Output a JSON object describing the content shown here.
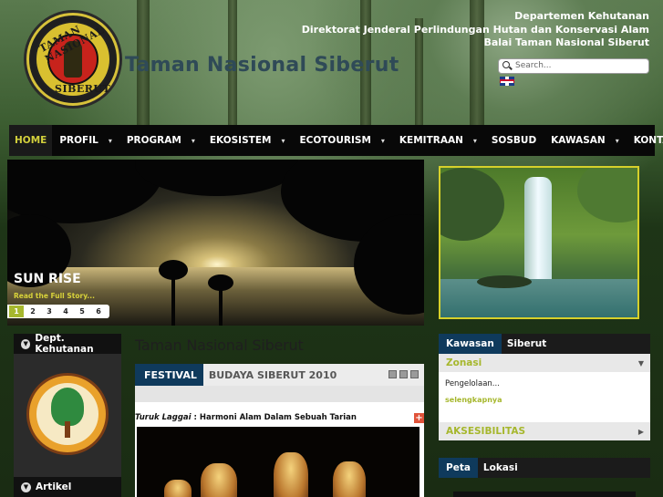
{
  "header": {
    "logo_top": "TAMAN NASIONAL",
    "logo_bottom": "SIBERUT",
    "site_title": "Taman Nasional Siberut",
    "org_lines": [
      "Departemen Kehutanan",
      "Direktorat Jenderal Perlindungan Hutan dan Konservasi Alam",
      "Balai Taman Nasional Siberut"
    ],
    "search_placeholder": "Search...",
    "language_flag": "uk-flag-icon"
  },
  "nav": {
    "items": [
      {
        "label": "HOME",
        "dropdown": false,
        "active": true
      },
      {
        "label": "PROFIL",
        "dropdown": true
      },
      {
        "label": "PROGRAM",
        "dropdown": true
      },
      {
        "label": "EKOSISTEM",
        "dropdown": true
      },
      {
        "label": "ECOTOURISM",
        "dropdown": true
      },
      {
        "label": "KEMITRAAN",
        "dropdown": true
      },
      {
        "label": "SOSBUD",
        "dropdown": false
      },
      {
        "label": "KAWASAN",
        "dropdown": true
      },
      {
        "label": "KONTAK",
        "dropdown": false
      }
    ]
  },
  "slideshow": {
    "title": "SUN RISE",
    "read_more": "Read the Full Story...",
    "pages": [
      "1",
      "2",
      "3",
      "4",
      "5",
      "6"
    ],
    "current": "1"
  },
  "left_sidebar": {
    "box1": "Dept. Kehutanan",
    "box2": "Artikel"
  },
  "main": {
    "heading": "Taman Nasional Siberut",
    "tab_category": "FESTIVAL",
    "tab_title": "BUDAYA SIBERUT 2010",
    "caption_italic": "Turuk Laggai",
    "caption_rest": " : Harmoni Alam Dalam Sebuah Tarian"
  },
  "right_sidebar": {
    "header_a": "Kawasan",
    "header_b": "Siberut",
    "section1": "Zonasi",
    "section1_text": "Pengelolaan...",
    "section1_more": "selengkapnya",
    "section2": "AKSESIBILITAS",
    "map_header_a": "Peta",
    "map_header_b": "Lokasi"
  },
  "colors": {
    "accent": "#a6b72d",
    "nav_bg": "#080808",
    "tab_blue": "#0f3a5c",
    "frame_yellow": "#d6d02b"
  }
}
